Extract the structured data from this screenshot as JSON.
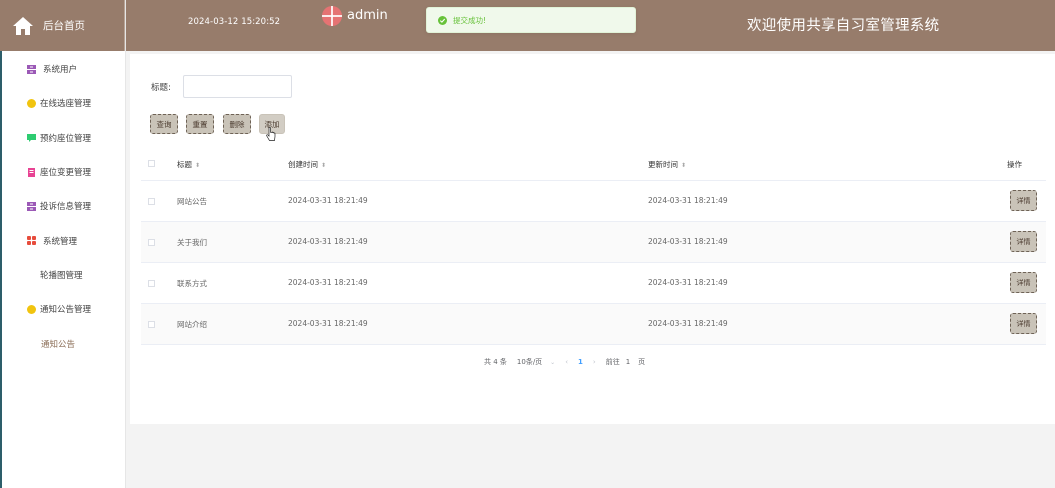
{
  "brand": {
    "label": "后台首页"
  },
  "header": {
    "time": "2024-03-12 15:20:52",
    "user": "admin",
    "title": "欢迎使用共享自习室管理系统"
  },
  "toast": {
    "text": "提交成功!"
  },
  "sidebar": {
    "items": [
      {
        "label": "系统用户",
        "icon": "user-box-icon",
        "color": "#9b59b6"
      },
      {
        "label": "在线选座管理",
        "icon": "circle-icon",
        "color": "#f1c40f"
      },
      {
        "label": "预约座位管理",
        "icon": "chat-icon",
        "color": "#2ecc71"
      },
      {
        "label": "座位变更管理",
        "icon": "document-icon",
        "color": "#e84393"
      },
      {
        "label": "投诉信息管理",
        "icon": "user-box-icon",
        "color": "#9b59b6"
      },
      {
        "label": "系统管理",
        "icon": "grid-icon",
        "color": "#e74c3c"
      },
      {
        "label": "轮播图管理"
      },
      {
        "label": "通知公告管理",
        "icon": "circle-icon",
        "color": "#f1c40f"
      },
      {
        "label": "通知公告"
      }
    ]
  },
  "search": {
    "label": "标题:",
    "value": "",
    "placeholder": ""
  },
  "buttons": {
    "query": "查询",
    "reset": "重置",
    "delete": "删除",
    "add": "添加"
  },
  "table": {
    "columns": {
      "title": "标题",
      "created": "创建时间",
      "updated": "更新时间",
      "op": "操作"
    },
    "rows": [
      {
        "title": "网站公告",
        "created": "2024-03-31 18:21:49",
        "updated": "2024-03-31 18:21:49",
        "action": "详情"
      },
      {
        "title": "关于我们",
        "created": "2024-03-31 18:21:49",
        "updated": "2024-03-31 18:21:49",
        "action": "详情"
      },
      {
        "title": "联系方式",
        "created": "2024-03-31 18:21:49",
        "updated": "2024-03-31 18:21:49",
        "action": "详情"
      },
      {
        "title": "网站介绍",
        "created": "2024-03-31 18:21:49",
        "updated": "2024-03-31 18:21:49",
        "action": "详情"
      }
    ]
  },
  "pagination": {
    "total": "共 4 条",
    "page_size": "10条/页",
    "current": "1",
    "goto_label": "前往",
    "goto_value": "1",
    "page_suffix": "页"
  },
  "colors": {
    "header_bg": "#977c6b",
    "button_bg": "#c9c3b8",
    "success": "#67c23a",
    "active_page": "#409eff"
  }
}
